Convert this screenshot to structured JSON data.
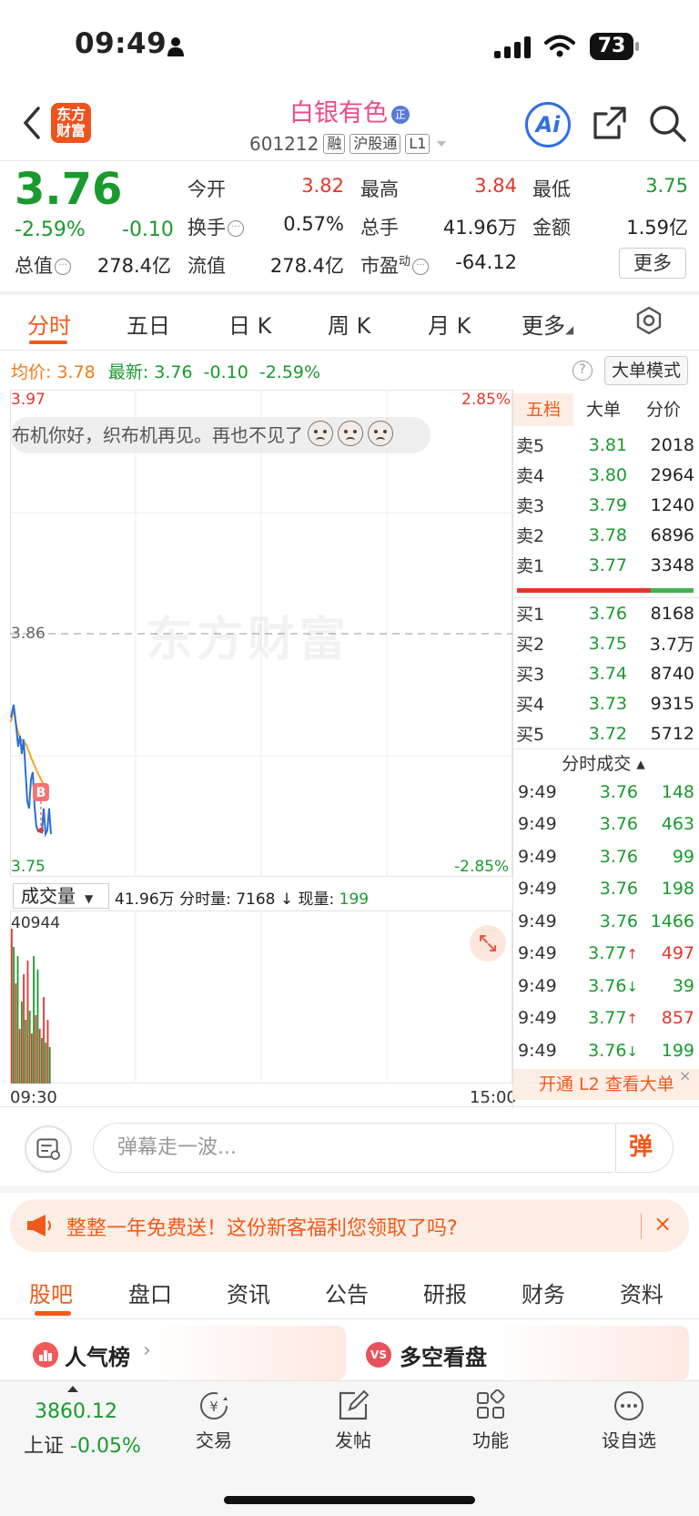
{
  "status_bar": {
    "time": "09:49",
    "battery": "73"
  },
  "header": {
    "logo_line1": "东方",
    "logo_line2": "财富",
    "stock_name": "白银有色",
    "name_badge": "正",
    "stock_code": "601212",
    "tags": [
      "融",
      "沪股通",
      "L1"
    ],
    "ai_label": "Ai"
  },
  "quote": {
    "price": "3.76",
    "change_pct": "-2.59%",
    "change_val": "-0.10",
    "fields": {
      "open_label": "今开",
      "open": "3.82",
      "high_label": "最高",
      "high": "3.84",
      "low_label": "最低",
      "low": "3.75",
      "turnover_label": "换手",
      "turnover": "0.57%",
      "volume_label": "总手",
      "volume": "41.96万",
      "amount_label": "金额",
      "amount": "1.59亿",
      "mktcap_label": "总值",
      "mktcap": "278.4亿",
      "float_label": "流值",
      "float": "278.4亿",
      "pe_label": "市盈",
      "pe_sup": "动",
      "pe": "-64.12"
    },
    "more_label": "更多"
  },
  "chart_tabs": [
    "分时",
    "五日",
    "日 K",
    "周 K",
    "月 K",
    "更多"
  ],
  "intraday": {
    "avg_label": "均价:",
    "avg_value": "3.78",
    "latest_label": "最新:",
    "latest_value": "3.76",
    "latest_change": "-0.10",
    "latest_pct": "-2.59%",
    "help_label": "?",
    "big_order_label": "大单模式",
    "danmu_text": "布机你好，织布机再见。再也不见了",
    "watermark": "东方财富",
    "axis_top_left": "3.97",
    "axis_top_right": "2.85%",
    "axis_mid": "3.86",
    "axis_bottom_left": "3.75",
    "axis_bottom_right": "-2.85%",
    "marker": "B"
  },
  "volume": {
    "selector_label": "成交量",
    "info_total": "41.96万",
    "info_rest": "分时量: 7168 ↓ 现量:",
    "info_now": "199",
    "axis_top": "40944",
    "time_start": "09:30",
    "time_end": "15:00"
  },
  "orderbook": {
    "tabs": [
      "五档",
      "大单",
      "分价"
    ],
    "asks": [
      {
        "label": "卖5",
        "price": "3.81",
        "vol": "2018"
      },
      {
        "label": "卖4",
        "price": "3.80",
        "vol": "2964"
      },
      {
        "label": "卖3",
        "price": "3.79",
        "vol": "1240"
      },
      {
        "label": "卖2",
        "price": "3.78",
        "vol": "6896"
      },
      {
        "label": "卖1",
        "price": "3.77",
        "vol": "3348"
      }
    ],
    "bids": [
      {
        "label": "买1",
        "price": "3.76",
        "vol": "8168"
      },
      {
        "label": "买2",
        "price": "3.75",
        "vol": "3.7万"
      },
      {
        "label": "买3",
        "price": "3.74",
        "vol": "8740"
      },
      {
        "label": "买4",
        "price": "3.73",
        "vol": "9315"
      },
      {
        "label": "买5",
        "price": "3.72",
        "vol": "5712"
      }
    ],
    "sell_share": 0.76
  },
  "trades": {
    "header": "分时成交 ▴",
    "rows": [
      {
        "time": "9:49",
        "price": "3.76",
        "vol": "148",
        "dir": ""
      },
      {
        "time": "9:49",
        "price": "3.76",
        "vol": "463",
        "dir": ""
      },
      {
        "time": "9:49",
        "price": "3.76",
        "vol": "99",
        "dir": ""
      },
      {
        "time": "9:49",
        "price": "3.76",
        "vol": "198",
        "dir": ""
      },
      {
        "time": "9:49",
        "price": "3.76",
        "vol": "1466",
        "dir": ""
      },
      {
        "time": "9:49",
        "price": "3.77↑",
        "vol": "497",
        "dir": "up"
      },
      {
        "time": "9:49",
        "price": "3.76↓",
        "vol": "39",
        "dir": "down"
      },
      {
        "time": "9:49",
        "price": "3.77↑",
        "vol": "857",
        "dir": "up"
      },
      {
        "time": "9:49",
        "price": "3.76↓",
        "vol": "199",
        "dir": "down"
      }
    ],
    "l2_banner": "开通 L2 查看大单",
    "l2_close": "×"
  },
  "comment": {
    "placeholder": "弹幕走一波...",
    "send_label": "弹"
  },
  "promo": {
    "text": "整整一年免费送！这份新客福利您领取了吗?",
    "close": "×"
  },
  "bottom_tabs": [
    "股吧",
    "盘口",
    "资讯",
    "公告",
    "研报",
    "财务",
    "资料"
  ],
  "cards": {
    "hot_title": "人气榜",
    "hot_chevron": "›",
    "vs_icon": "VS",
    "vs_title": "多空看盘"
  },
  "bottom_nav": {
    "index_value": "3860.12",
    "index_name": "上证",
    "index_pct": "-0.05%",
    "items": [
      "交易",
      "发帖",
      "功能",
      "设自选"
    ]
  },
  "colors": {
    "up": "#e5362b",
    "down": "#1a9a2e",
    "accent": "#f05a1a",
    "avg_line": "#f5a623",
    "price_line": "#2a6fd6"
  }
}
